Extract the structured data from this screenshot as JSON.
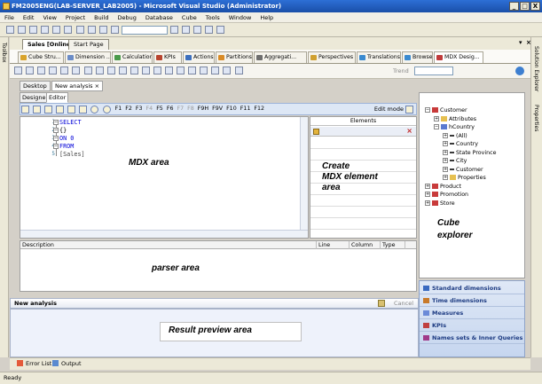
{
  "window": {
    "title": "FM2005ENG(LAB-SERVER_LAB2005) - Microsoft Visual Studio (Administrator)",
    "minimize": "_",
    "maximize": "□",
    "close": "X"
  },
  "menu": [
    "File",
    "Edit",
    "View",
    "Project",
    "Build",
    "Debug",
    "Database",
    "Cube",
    "Tools",
    "Window",
    "Help"
  ],
  "left_toolbox_label": "Toolbox",
  "right_panels": {
    "solution_explorer": "Solution Explorer",
    "properties": "Properties"
  },
  "doc_tabs": [
    {
      "label": "Sales [Online]",
      "active": true
    },
    {
      "label": "Start Page",
      "active": false
    }
  ],
  "designer_tabs": [
    {
      "label": "Cube Stru...",
      "color": "#d9a32a"
    },
    {
      "label": "Dimension ...",
      "color": "#6b8cc7"
    },
    {
      "label": "Calculations",
      "color": "#4a9a4a"
    },
    {
      "label": "KPIs",
      "color": "#b8442f"
    },
    {
      "label": "Actions",
      "color": "#3c6fbe"
    },
    {
      "label": "Partitions",
      "color": "#d98b26"
    },
    {
      "label": "Aggregati...",
      "color": "#6e6e6e"
    },
    {
      "label": "Perspectives",
      "color": "#d0a030"
    },
    {
      "label": "Translations",
      "color": "#3a8ad0"
    },
    {
      "label": "Browser",
      "color": "#3a8ad0"
    },
    {
      "label": "MDX Desig...",
      "color": "#c03a3a",
      "active": true
    }
  ],
  "toolbar2": {
    "trend_label": "Trend"
  },
  "sub_tabs": [
    {
      "label": "Desktop",
      "active": false
    },
    {
      "label": "New analysis",
      "active": true,
      "close": "×"
    }
  ],
  "inner_tabs": [
    {
      "label": "Designer",
      "active": false
    },
    {
      "label": "Editor",
      "active": true
    }
  ],
  "editor_toolbar": {
    "fkeys": [
      {
        "label": "F1",
        "enabled": true
      },
      {
        "label": "F2",
        "enabled": true
      },
      {
        "label": "F3",
        "enabled": true
      },
      {
        "label": "F4",
        "enabled": false
      },
      {
        "label": "F5",
        "enabled": true
      },
      {
        "label": "F6",
        "enabled": true
      },
      {
        "label": "F7",
        "enabled": false
      },
      {
        "label": "F8",
        "enabled": false
      },
      {
        "label": "F9H",
        "enabled": true
      },
      {
        "label": "F9V",
        "enabled": true
      },
      {
        "label": "F10",
        "enabled": true
      },
      {
        "label": "F11",
        "enabled": true
      },
      {
        "label": "F12",
        "enabled": true
      }
    ],
    "edit_mode": "Edit mode"
  },
  "mdx_code": [
    {
      "line": "1",
      "text": "SELECT",
      "kind": "kw"
    },
    {
      "line": "2",
      "text": "{}",
      "kind": "plain"
    },
    {
      "line": "3",
      "text": "ON 0",
      "kind": "kw"
    },
    {
      "line": "4",
      "text": "FROM",
      "kind": "kw"
    },
    {
      "line": "5",
      "text": "[Sales]",
      "kind": "gray"
    }
  ],
  "annotations": {
    "mdx_area": "MDX area",
    "create_mdx": [
      "Create",
      "MDX element",
      "area"
    ],
    "parser_area": "parser area",
    "result_preview": "Result preview area",
    "cube_explorer": [
      "Cube",
      "explorer"
    ]
  },
  "elements_panel": {
    "header": "Elements"
  },
  "parser_columns": [
    "Description",
    "Line",
    "Column",
    "Type"
  ],
  "result_header": {
    "title": "New analysis",
    "cancel": "Cancel"
  },
  "cube_tree": [
    {
      "label": "Customer",
      "level": 0,
      "toggle": "−",
      "icon": "cube-dim"
    },
    {
      "label": "Attributes",
      "level": 1,
      "toggle": "+",
      "icon": "folder"
    },
    {
      "label": "hCountry",
      "level": 1,
      "toggle": "−",
      "icon": "hierarchy"
    },
    {
      "label": "(All)",
      "level": 2,
      "toggle": "+",
      "icon": "level"
    },
    {
      "label": "Country",
      "level": 2,
      "toggle": "+",
      "icon": "level"
    },
    {
      "label": "State Province",
      "level": 2,
      "toggle": "+",
      "icon": "level"
    },
    {
      "label": "City",
      "level": 2,
      "toggle": "+",
      "icon": "level"
    },
    {
      "label": "Customer",
      "level": 2,
      "toggle": "+",
      "icon": "level"
    },
    {
      "label": "Properties",
      "level": 2,
      "toggle": "+",
      "icon": "folder"
    },
    {
      "label": "Product",
      "level": 0,
      "toggle": "+",
      "icon": "cube-dim"
    },
    {
      "label": "Promotion",
      "level": 0,
      "toggle": "+",
      "icon": "cube-dim"
    },
    {
      "label": "Store",
      "level": 0,
      "toggle": "+",
      "icon": "cube-dim"
    }
  ],
  "cube_buttons": [
    {
      "label": "Standard dimensions",
      "icon": "dimension-icon"
    },
    {
      "label": "Time dimensions",
      "icon": "clock-icon"
    },
    {
      "label": "Measures",
      "icon": "measures-icon"
    },
    {
      "label": "KPIs",
      "icon": "kpi-icon"
    },
    {
      "label": "Names sets & Inner Queries",
      "icon": "named-set-icon"
    }
  ],
  "bottom_tabs": [
    "Error List",
    "Output"
  ],
  "status": "Ready"
}
